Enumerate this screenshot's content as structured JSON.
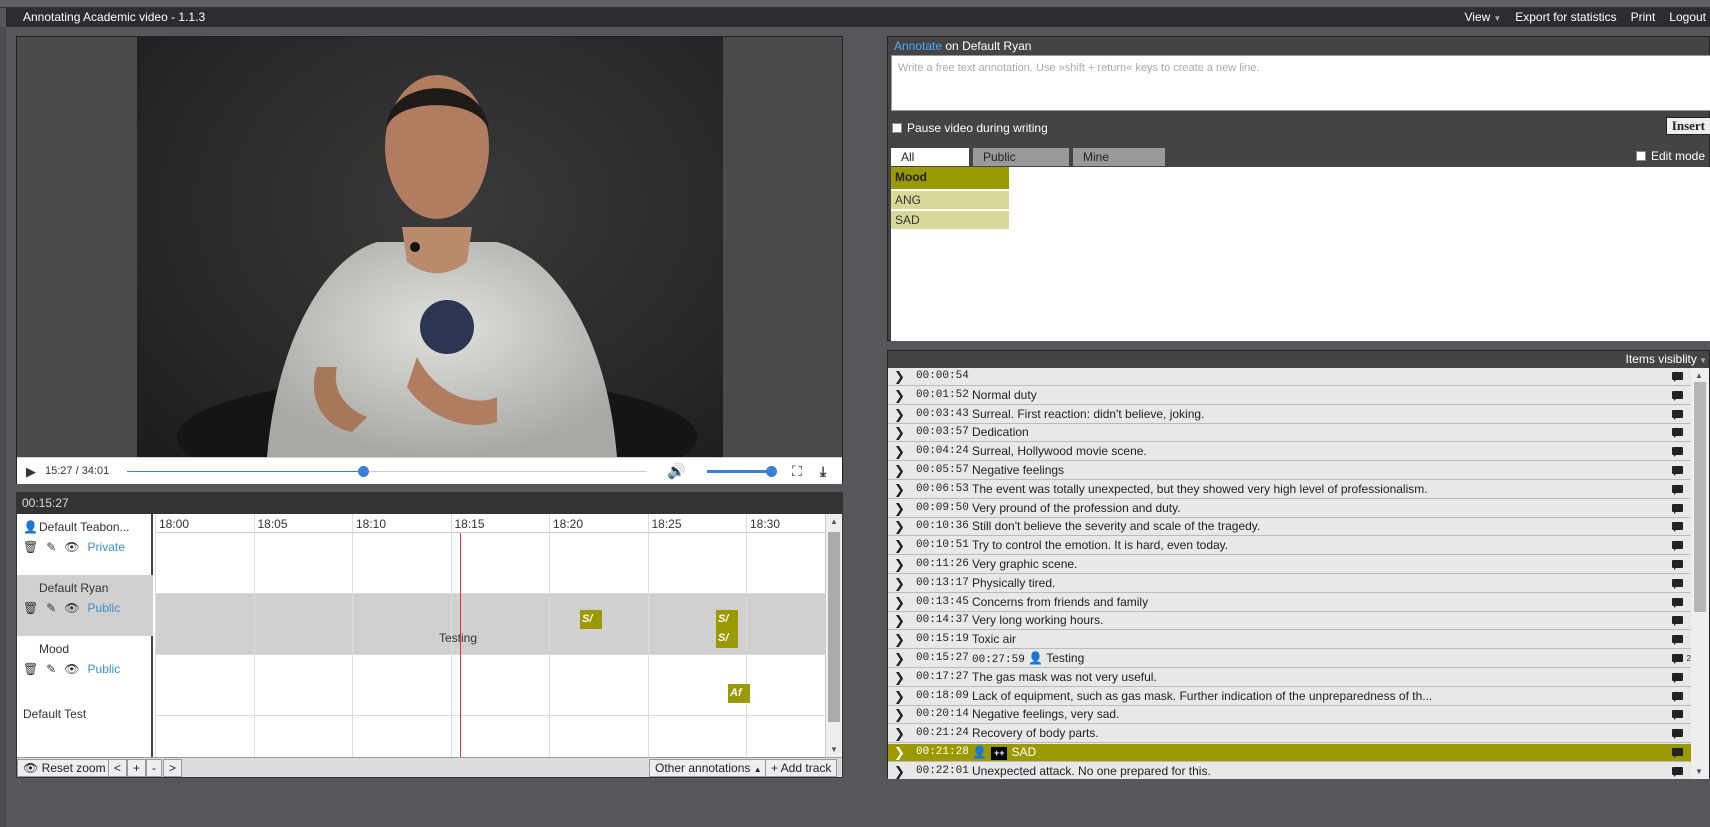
{
  "app": {
    "title": "Annotating Academic video - 1.1.3",
    "menu": {
      "view": "View",
      "export": "Export for statistics",
      "print": "Print",
      "logout": "Logout"
    }
  },
  "video": {
    "time_display": "15:27 / 34:01",
    "progress": 0.454,
    "volume": 1.0
  },
  "timeline": {
    "current_time": "00:15:27",
    "ticks": [
      "18:00",
      "18:05",
      "18:10",
      "18:15",
      "18:20",
      "18:25",
      "18:30"
    ],
    "tracks": [
      {
        "name": "Default Teabon...",
        "visibility": "Private"
      },
      {
        "name": "Default Ryan",
        "visibility": "Public"
      },
      {
        "name": "Mood",
        "visibility": "Public"
      },
      {
        "name": "Default Test",
        "visibility": ""
      }
    ],
    "annotations": {
      "sa1": "S/",
      "sa2": "S/",
      "sa3": "S/",
      "testing": "Testing",
      "af": "Af"
    },
    "footer": {
      "reset": "Reset zoom",
      "prev": "<",
      "plus": "+",
      "minus": "-",
      "next": ">",
      "other": "Other annotations",
      "add": "+ Add track"
    }
  },
  "annotate": {
    "link": "Annotate",
    "on": " on Default Ryan",
    "placeholder": "Write a free text annotation. Use »shift + return« keys to create a new line.",
    "pause_label": "Pause video during writing",
    "insert": "Insert",
    "tabs": [
      "All",
      "Public",
      "Mine"
    ],
    "edit_mode": "Edit mode",
    "category": {
      "name": "Mood",
      "items": [
        "ANG",
        "SAD"
      ]
    }
  },
  "list": {
    "header": "Items visiblity",
    "rows": [
      {
        "time": "00:00:54",
        "text": ""
      },
      {
        "time": "00:01:52",
        "text": "Normal duty"
      },
      {
        "time": "00:03:43",
        "text": "Surreal. First reaction: didn't believe, joking."
      },
      {
        "time": "00:03:57",
        "text": "Dedication"
      },
      {
        "time": "00:04:24",
        "text": "Surreal, Hollywood movie scene."
      },
      {
        "time": "00:05:57",
        "text": "Negative feelings"
      },
      {
        "time": "00:06:53",
        "text": "The event was totally unexpected, but they showed very high level of professionalism."
      },
      {
        "time": "00:09:50",
        "text": "Very pround of the profession and duty."
      },
      {
        "time": "00:10:36",
        "text": "Still don't believe the severity and scale of the tragedy."
      },
      {
        "time": "00:10:51",
        "text": "Try to control the emotion. It is hard, even today."
      },
      {
        "time": "00:11:26",
        "text": "Very graphic scene."
      },
      {
        "time": "00:13:17",
        "text": "Physically tired."
      },
      {
        "time": "00:13:45",
        "text": "Concerns from friends and family"
      },
      {
        "time": "00:14:37",
        "text": "Very long working hours."
      },
      {
        "time": "00:15:19",
        "text": "Toxic air"
      },
      {
        "time": "00:15:27",
        "text": "00:27:59",
        "user": "Testing",
        "count": "2"
      },
      {
        "time": "00:17:27",
        "text": "The gas mask was not very useful."
      },
      {
        "time": "00:18:09",
        "text": "Lack of equipment, such as gas mask. Further indication of the unpreparedness of th..."
      },
      {
        "time": "00:20:14",
        "text": "Negative feelings, very sad."
      },
      {
        "time": "00:21:24",
        "text": "Recovery of body parts."
      },
      {
        "time": "00:21:28",
        "text": "SAD",
        "badge": "++",
        "highlight": true
      },
      {
        "time": "00:22:01",
        "text": "Unexpected attack. No one prepared for this."
      }
    ]
  }
}
